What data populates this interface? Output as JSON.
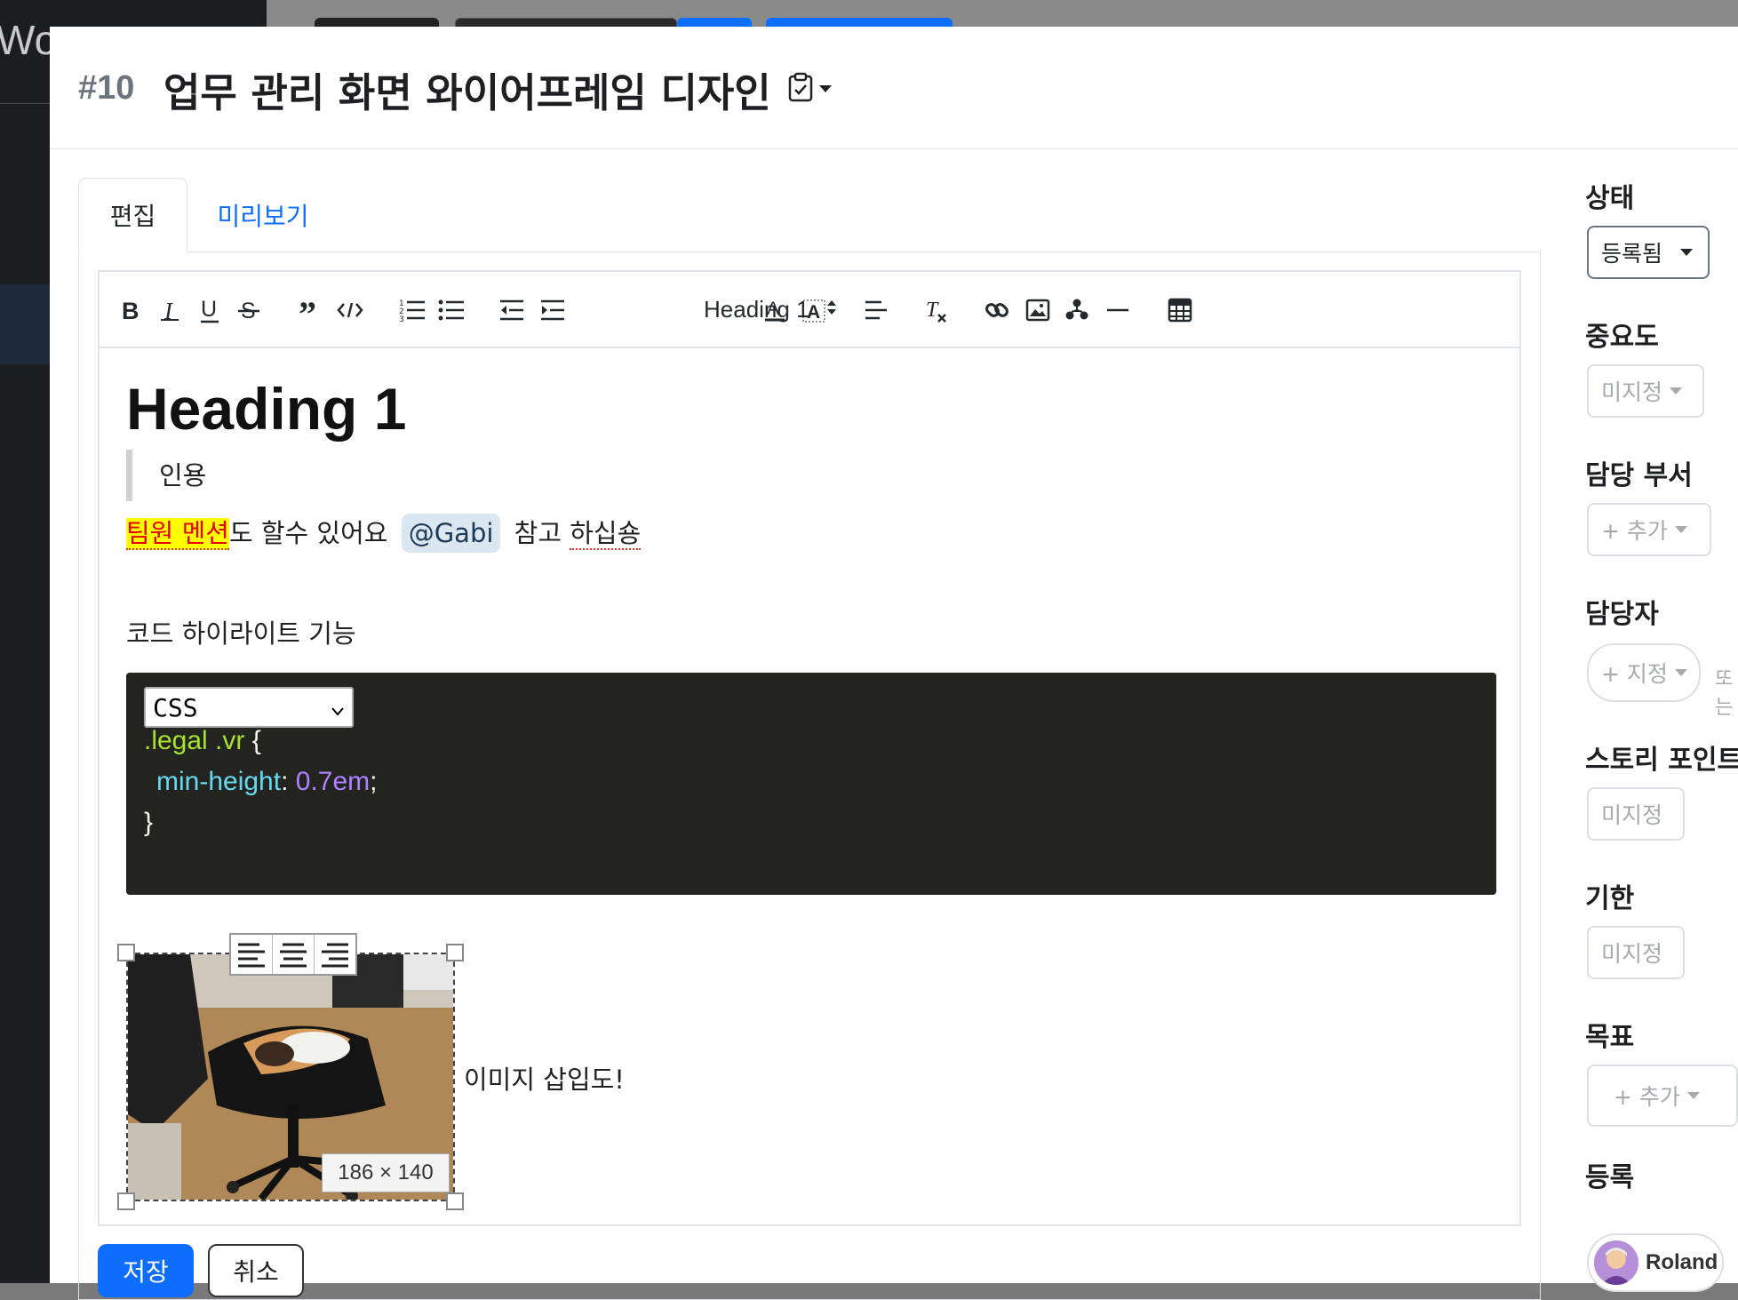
{
  "background": {
    "app_logo_partial": "Wo"
  },
  "header": {
    "issue_number": "#10",
    "title": "업무 관리 화면 와이어프레임 디자인"
  },
  "tabs": [
    {
      "label": "편집",
      "active": true
    },
    {
      "label": "미리보기",
      "active": false
    }
  ],
  "toolbar": {
    "heading_value": "Heading 1",
    "buttons": [
      "bold-icon",
      "italic-icon",
      "underline-icon",
      "strikethrough-icon",
      "quote-icon",
      "code-icon",
      "ordered-list-icon",
      "bullet-list-icon",
      "outdent-icon",
      "indent-icon",
      "heading-select",
      "text-color-icon",
      "background-color-icon",
      "align-icon",
      "clear-format-icon",
      "link-icon",
      "image-icon",
      "mention-icon",
      "divider-icon",
      "table-icon"
    ]
  },
  "content": {
    "heading": "Heading 1",
    "blockquote": "인용",
    "mention_line": {
      "highlight": "팀원 멘션",
      "after_highlight": "도 할수 있어요",
      "mention": "@Gabi",
      "after_mention_1": "참고 ",
      "after_mention_2": "하십숑"
    },
    "code_label": "코드 하이라이트 기능",
    "code": {
      "language": "CSS",
      "line1_selector": ".legal .vr",
      "line1_brace": " {",
      "line2_prop": "min-height",
      "line2_colon": ": ",
      "line2_value": "0.7em",
      "line2_end": ";",
      "line3": "}"
    },
    "image": {
      "size_label": "186 × 140"
    },
    "image_caption": "이미지 삽입도!"
  },
  "actions": {
    "save_label": "저장",
    "cancel_label": "취소"
  },
  "sidebar": {
    "status_label": "상태",
    "status_value": "등록됨",
    "priority_label": "중요도",
    "priority_value": "미지정",
    "department_label": "담당 부서",
    "department_value": "+ 추가",
    "assignee_label": "담당자",
    "assignee_value": "+ 지정",
    "assignee_extra": "또는",
    "story_points_label": "스토리 포인트",
    "story_points_value": "미지정",
    "due_label": "기한",
    "due_value": "미지정",
    "goal_label": "목표",
    "goal_value": "+ 추가",
    "registrant_label": "등록",
    "registrant_name": "Roland"
  },
  "colors": {
    "primary": "#0d6efd",
    "highlight_bg": "#ffff00",
    "highlight_text": "#e60000",
    "code_bg": "#23241f"
  }
}
